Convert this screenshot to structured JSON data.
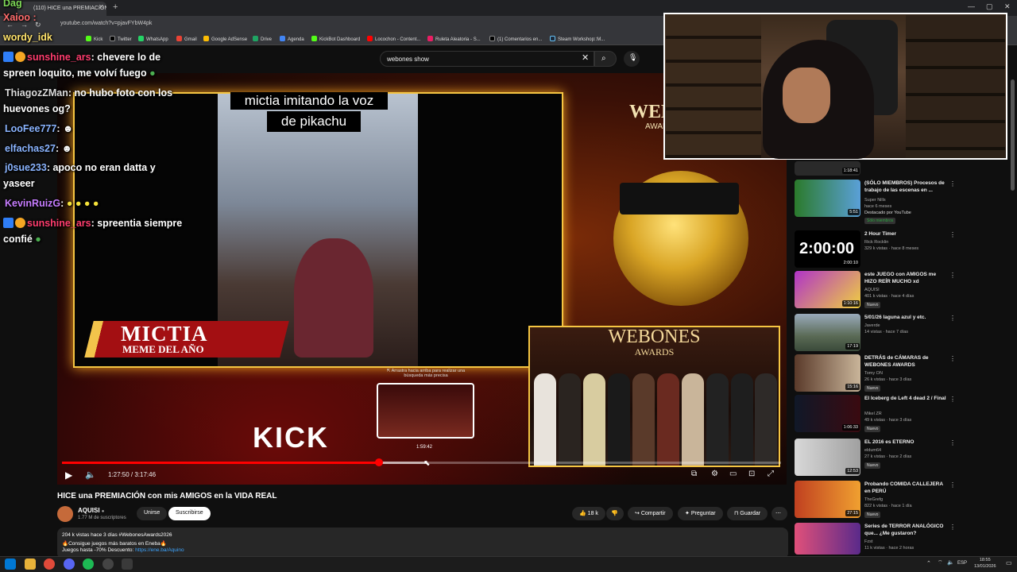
{
  "browser": {
    "tab_title": "(110) HICE una PREMIACION co",
    "url": "youtube.com/watch?v=pjavFYbW4pk",
    "bookmarks": [
      "Kick",
      "Twitter",
      "WhatsApp",
      "Gmail",
      "Google AdSense",
      "Drive",
      "Agenda",
      "KickBot Dashboard",
      "Locochon - Content...",
      "Ruleta Aleatoria - S...",
      "(1) Comentarios en...",
      "Steam Workshop::M..."
    ]
  },
  "search": {
    "query": "webones show"
  },
  "player": {
    "clip_caption_1": "mictia imitando la voz",
    "clip_caption_2": "de pikachu",
    "banner_title": "MICTIA",
    "banner_subtitle": "MEME DEL AÑO",
    "brand_right": "WEBO",
    "brand_right_sub": "AWAR",
    "inset_title": "WEBONES",
    "inset_subtitle": "AWARDS",
    "kick_logo": "KICK",
    "preview_hint": "⇱ Arrastra hacia arriba para realizar una búsqueda más precisa",
    "preview_time": "1:59:42",
    "time_display": "1:27:50 / 3:17:46",
    "progress": 0.44
  },
  "video": {
    "title": "HICE una PREMIACIÓN con mis AMIGOS en la VIDA REAL",
    "channel": "AQUISI",
    "subscribers": "1.77 M de suscriptores",
    "join_label": "Unirse",
    "subscribe_label": "Suscribirse",
    "likes": "18 k",
    "share_label": "Compartir",
    "ask_label": "Preguntar",
    "save_label": "Guardar",
    "stats": "204 k vistas  hace 3 días  #WebonesAwards2026",
    "desc_line1": "🔥Consigue juegos más baratos en Eneba🔥",
    "desc_line2": "Juegos hasta -70% Descuento: ",
    "desc_link": "https://ene.ba/Aquino"
  },
  "sidebar": [
    {
      "title": "",
      "channel": "",
      "meta": "",
      "duration": "1:18:41",
      "badge": ""
    },
    {
      "title": "(SÓLO MIEMBROS) Procesos de trabajo de las escenas en ...",
      "channel": "Super Nills",
      "meta": "hace 6 meses",
      "extra": "Destacado por YouTube",
      "badge": "Sólo miembros",
      "duration": "5:51"
    },
    {
      "title": "2 Hour Timer",
      "channel": "Rick Rocklin",
      "meta": "329 k vistas · hace 8 meses",
      "badge": "",
      "duration": "2:00:10",
      "thumb_text": "2:00:00"
    },
    {
      "title": "este JUEGO con AMIGOS me HIZO REÍR MUCHO xd",
      "channel": "AQUISI",
      "meta": "401 k vistas · hace 4 días",
      "badge": "Nuevo",
      "duration": "1:10:16"
    },
    {
      "title": "5/01/26 laguna azul y etc.",
      "channel": "Javerde",
      "meta": "14 vistas · hace 7 días",
      "badge": "",
      "duration": "17:19"
    },
    {
      "title": "DETRÁS de CÁMARAS de WEBONES AWARDS",
      "channel": "Tomy ON",
      "meta": "26 k vistas · hace 3 días",
      "badge": "Nuevo",
      "duration": "15:16"
    },
    {
      "title": "El Iceberg de Left 4 dead 2 / Final",
      "channel": "Mikel ZR",
      "meta": "49 k vistas · hace 3 días",
      "badge": "Nuevo",
      "duration": "1:06:33"
    },
    {
      "title": "EL 2016 es ETERNO",
      "channel": "eldum64",
      "meta": "27 k vistas · hace 2 días",
      "badge": "Nuevo",
      "duration": "12:53"
    },
    {
      "title": "Probando COMIDA CALLEJERA en PERÚ",
      "channel": "TheGrefg",
      "meta": "822 k vistas · hace 1 día",
      "badge": "Nuevo",
      "duration": "27:15"
    },
    {
      "title": "Series de TERROR ANALÓGICO que... ¿Me gustaron?",
      "channel": "Fzst",
      "meta": "11 k vistas · hace 2 horas",
      "badge": "",
      "duration": "18:35"
    }
  ],
  "chat": {
    "top_names": [
      "Xaioo :",
      "wordy_idk"
    ],
    "messages": [
      {
        "user": "sunshine_ars",
        "text": ": chevere lo de",
        "cont": "spreen loquito, me volví fuego",
        "color": "#ff3d6e"
      },
      {
        "user": "ThiagozZMan",
        "text": ": no hubo foto con los",
        "cont": "huevones og?",
        "color": "#dddddd"
      },
      {
        "user": "LooFee777",
        "text": ":",
        "color": "#8ab4ff"
      },
      {
        "user": "elfachas27",
        "text": ":",
        "color": "#8ab4ff"
      },
      {
        "user": "j0sue233",
        "text": ": apoco no eran datta y",
        "cont": "yaseer",
        "color": "#8ab4ff"
      },
      {
        "user": "KevinRuizG",
        "text": ":",
        "color": "#c77dff"
      },
      {
        "user": "sunshine_ars",
        "text": ": spreentia siempre",
        "cont": "confié",
        "color": "#ff3d6e"
      }
    ]
  },
  "taskbar": {
    "lang": "ESP",
    "time": "18:55",
    "date": "13/01/2026"
  }
}
